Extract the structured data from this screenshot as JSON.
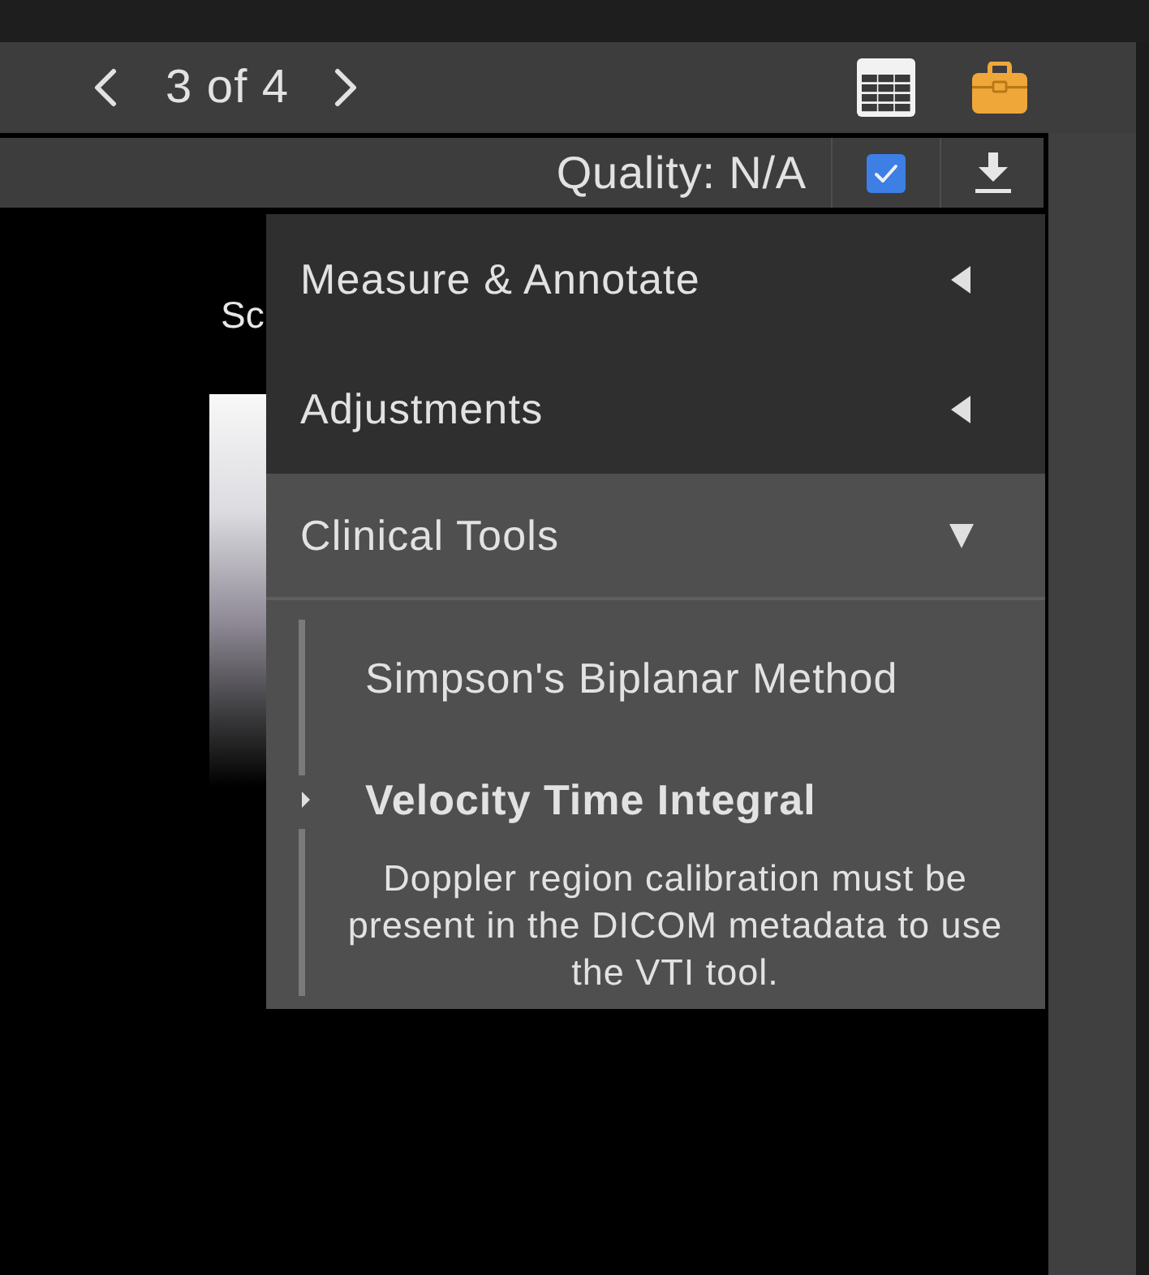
{
  "pager": {
    "position": "3 of 4"
  },
  "quality_bar": {
    "label": "Quality: N/A",
    "checked": true
  },
  "viewer": {
    "overlay_text": "Sc"
  },
  "menu": {
    "items": [
      {
        "label": "Measure & Annotate",
        "expanded": false
      },
      {
        "label": "Adjustments",
        "expanded": false
      },
      {
        "label": "Clinical Tools",
        "expanded": true,
        "children": [
          {
            "label": "Simpson's Biplanar Method",
            "selected": false
          },
          {
            "label": "Velocity Time Integral",
            "selected": true,
            "note": "Doppler region calibration must be present in the DICOM metadata to use the VTI tool."
          }
        ]
      }
    ]
  }
}
